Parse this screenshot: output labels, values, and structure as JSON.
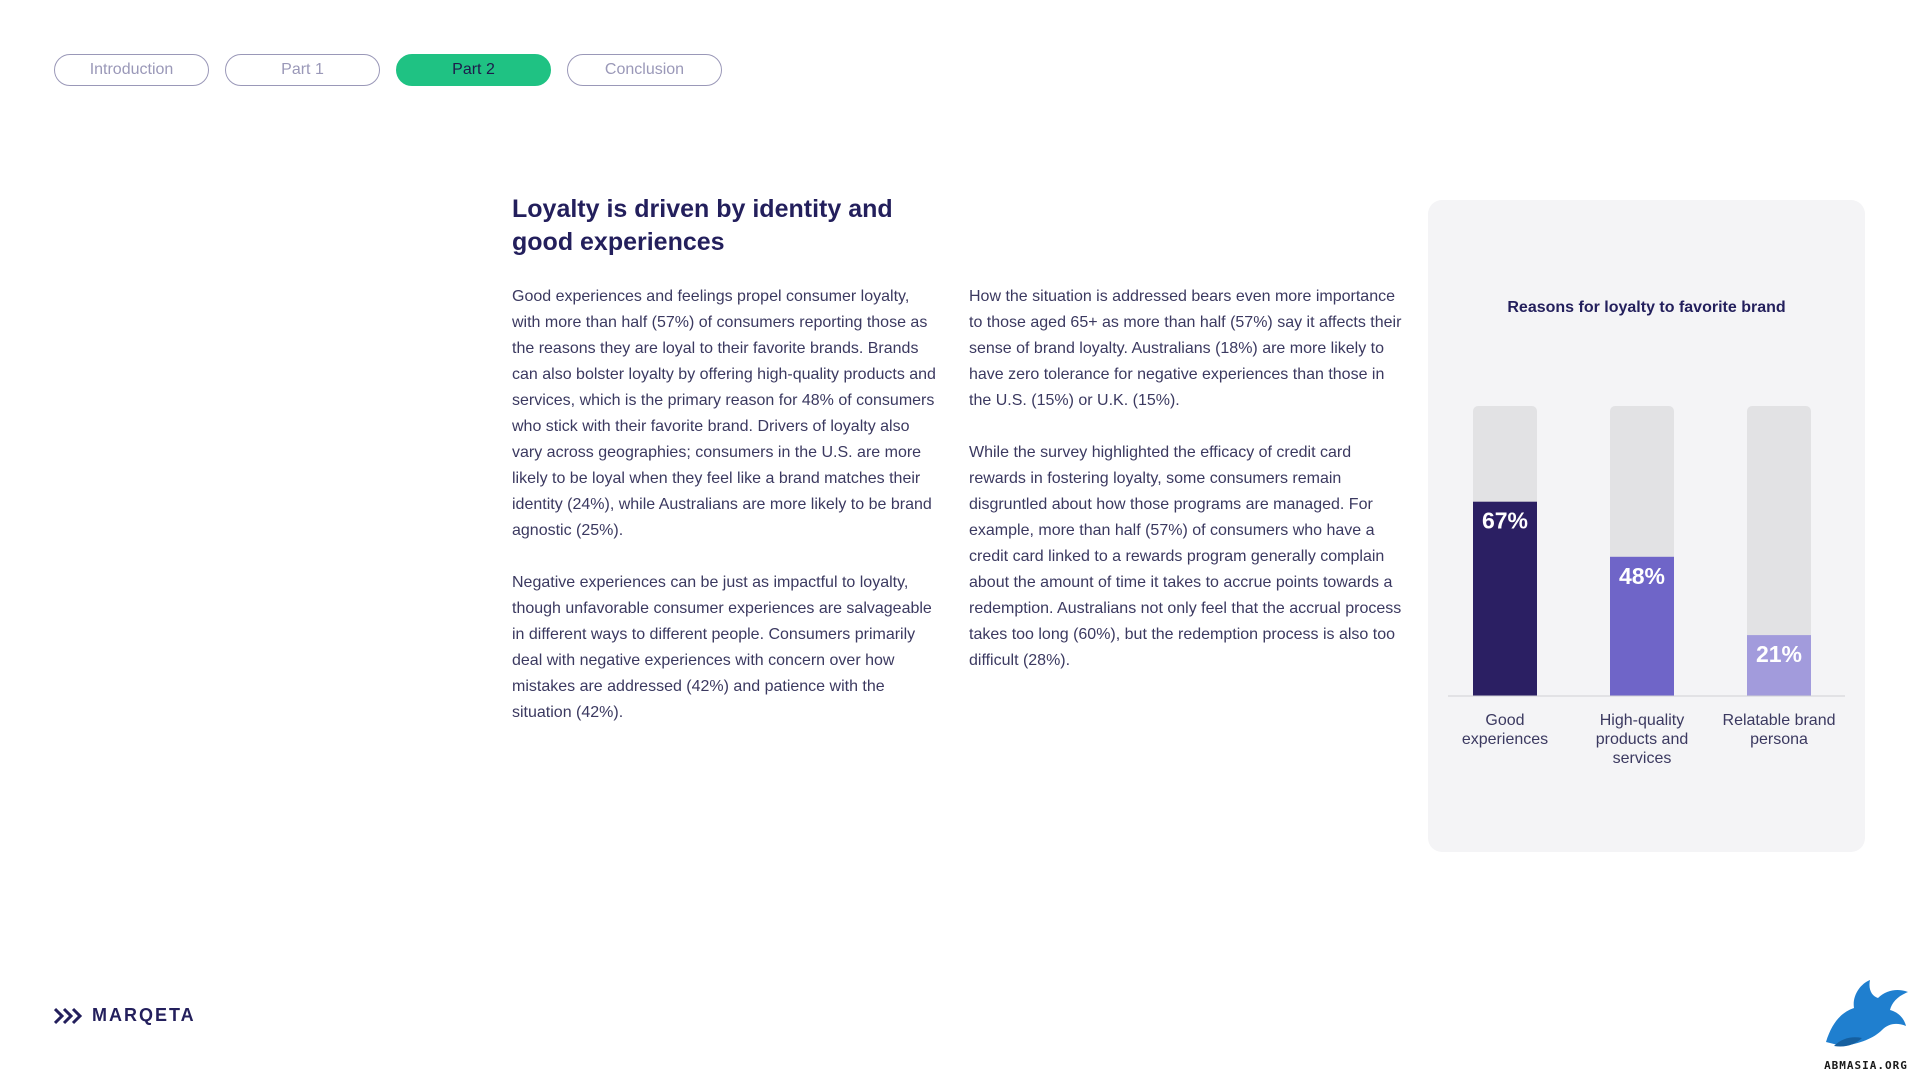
{
  "nav": {
    "items": [
      {
        "label": "Introduction",
        "active": false
      },
      {
        "label": "Part 1",
        "active": false
      },
      {
        "label": "Part 2",
        "active": true
      },
      {
        "label": "Conclusion",
        "active": false
      }
    ]
  },
  "article": {
    "title": "Loyalty is driven by identity and good experiences",
    "left_paragraphs": [
      "Good experiences and feelings propel consumer loyalty, with more than half (57%) of consumers reporting those as the reasons they are loyal to their favorite brands. Brands can also bolster loyalty by offering high-quality products and services, which is the primary reason for 48% of consumers who stick with their favorite brand. Drivers of loyalty also vary across geographies; consumers in the U.S. are more likely to be loyal when they feel like a brand matches their identity (24%), while Australians are more likely to be brand agnostic (25%).",
      "Negative experiences can be just as impactful to loyalty, though unfavorable consumer experiences are salvageable in different ways to different people. Consumers primarily deal with negative experiences with concern over how mistakes are addressed (42%) and patience with the situation (42%)."
    ],
    "right_paragraphs": [
      "How the situation is addressed bears even more importance to those aged 65+ as more than half (57%) say it affects their sense of brand loyalty. Australians (18%) are more likely to have zero tolerance for negative experiences than those in the U.S. (15%) or U.K. (15%).",
      "While the survey highlighted the efficacy of credit card rewards in fostering loyalty, some consumers remain disgruntled about how those programs are managed. For example, more than half (57%) of consumers who have a credit card linked to a rewards program generally complain about the amount of time it takes to accrue points towards a redemption. Australians not only feel that the accrual process takes too long (60%), but the redemption process is also too difficult (28%)."
    ]
  },
  "chart_data": {
    "type": "bar",
    "title": "Reasons for loyalty to favorite brand",
    "categories": [
      [
        "Good",
        "experiences"
      ],
      [
        "High-quality",
        "products and",
        "services"
      ],
      [
        "Relatable brand",
        "persona"
      ]
    ],
    "values": [
      67,
      48,
      21
    ],
    "value_labels": [
      "67%",
      "48%",
      "21%"
    ],
    "ylim": [
      0,
      100
    ],
    "grid": false,
    "legend": "none",
    "colors": [
      "#2b1f63",
      "#6f65c8",
      "#a29bdc"
    ],
    "track_color": "#e2e2e4"
  },
  "logo": {
    "text": "MARQETA",
    "color": "#231f5c"
  },
  "watermark": {
    "text": "ABMASIA.ORG"
  }
}
